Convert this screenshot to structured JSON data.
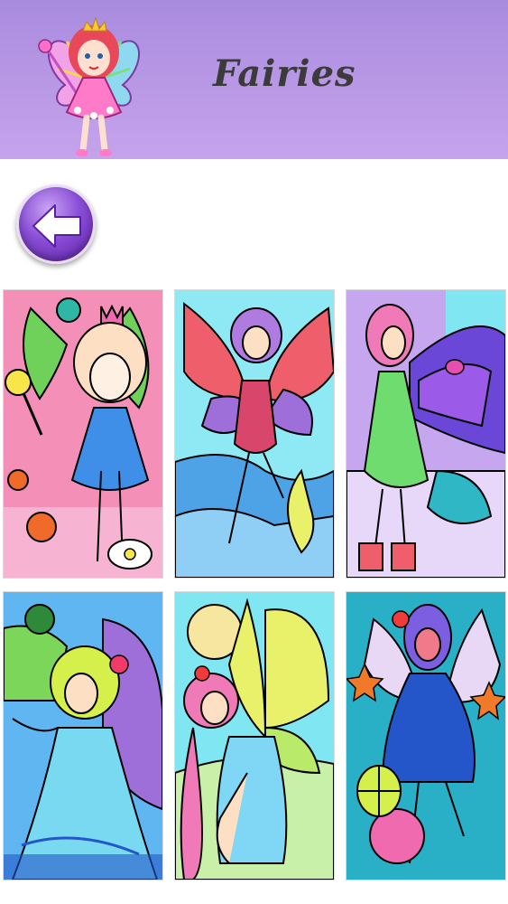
{
  "header": {
    "title": "Fairies",
    "mascot_icon": "fairy-mascot-icon"
  },
  "navigation": {
    "back_icon": "arrow-left-icon"
  },
  "gallery": {
    "items": [
      {
        "name": "fairy-1",
        "background": "#f48fb8",
        "dress": "#3f8ee8",
        "wing": "#6fd05a"
      },
      {
        "name": "fairy-2",
        "background": "#8fe9f5",
        "dress": "#d9466b",
        "wing": "#ef5e6b"
      },
      {
        "name": "fairy-3",
        "background": "#c7a6f0",
        "dress": "#6fdc6f",
        "wing": "#6a47d6"
      },
      {
        "name": "fairy-4",
        "background": "#5fb6f0",
        "dress": "#79d9f0",
        "wing": "#9e6fd9"
      },
      {
        "name": "fairy-5",
        "background": "#7fe6f2",
        "dress": "#7fd6f5",
        "wing": "#e9f06a"
      },
      {
        "name": "fairy-6",
        "background": "#2ab0c6",
        "dress": "#2456c9",
        "wing": "#e8d8f6"
      }
    ]
  }
}
